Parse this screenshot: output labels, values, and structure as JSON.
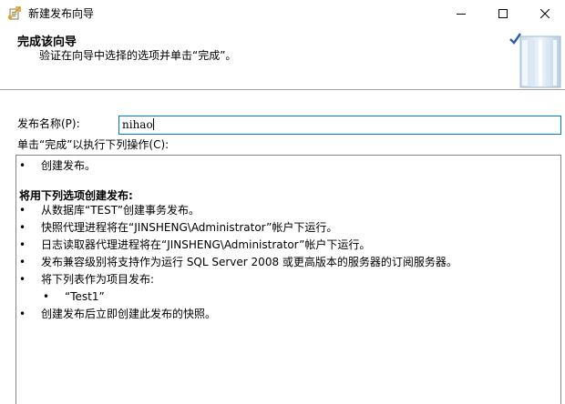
{
  "window": {
    "title": "新建发布向导"
  },
  "banner": {
    "title": "完成该向导",
    "subtitle": "验证在向导中选择的选项并单击“完成”。"
  },
  "form": {
    "name_label": "发布名称(P):",
    "name_value": "nihao",
    "actions_label": "单击“完成”以执行下列操作(C):"
  },
  "summary": {
    "first_bullet": "创建发布。",
    "section_heading": "将用下列选项创建发布:",
    "items": [
      "从数据库“TEST”创建事务发布。",
      "快照代理进程将在“JINSHENG\\Administrator”帐户下运行。",
      "日志读取器代理进程将在“JINSHENG\\Administrator”帐户下运行。",
      "发布兼容级别将支持作为运行 SQL Server 2008 或更高版本的服务器的订阅服务器。",
      "将下列表作为项目发布:"
    ],
    "sub_item": "“Test1”",
    "last_item": "创建发布后立即创建此发布的快照。",
    "bullet_char": "•"
  },
  "colors": {
    "focus_border": "#0078d7",
    "box_border": "#828790",
    "divider": "#a0a0a0"
  },
  "icons": {
    "app": "publication-wizard-icon",
    "banner": "wizard-complete-graphic",
    "minimize": "minimize-icon",
    "maximize": "maximize-icon",
    "close": "close-icon"
  }
}
